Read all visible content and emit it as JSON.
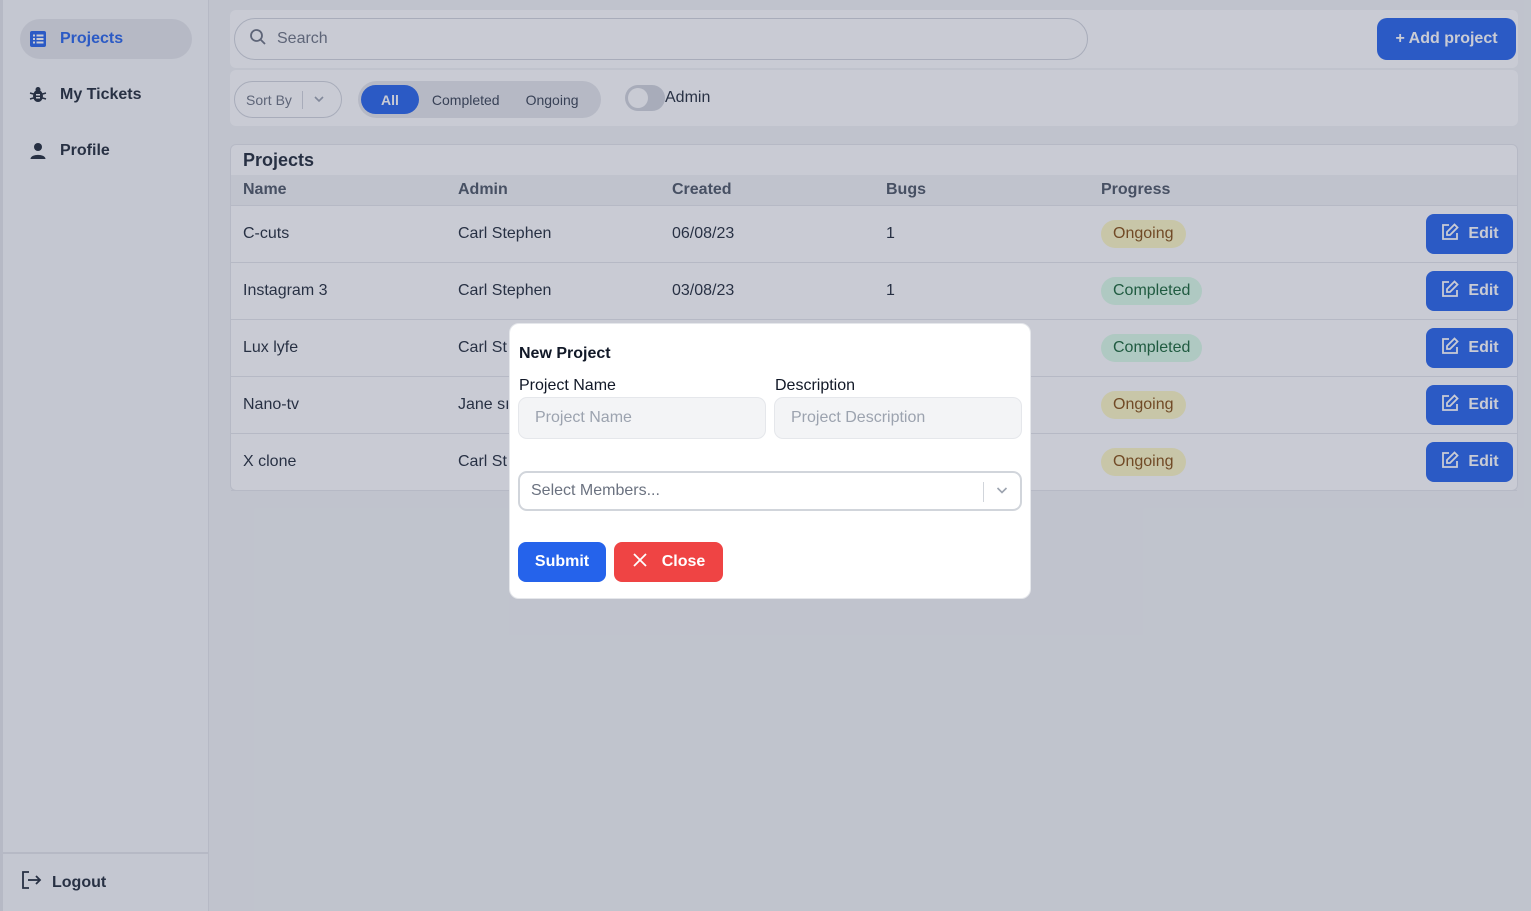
{
  "sidebar": {
    "items": [
      {
        "label": "Projects",
        "icon": "list-icon",
        "active": true
      },
      {
        "label": "My Tickets",
        "icon": "bug-icon"
      },
      {
        "label": "Profile",
        "icon": "user-icon"
      }
    ],
    "logout_label": "Logout"
  },
  "toolbar": {
    "search_placeholder": "Search",
    "add_label": "+ Add project"
  },
  "filters": {
    "sort_label": "Sort By",
    "segments": [
      "All",
      "Completed",
      "Ongoing"
    ],
    "active_segment": "All",
    "admin_label": "Admin",
    "admin_on": false
  },
  "table": {
    "title": "Projects",
    "columns": [
      "Name",
      "Admin",
      "Created",
      "Bugs",
      "Progress"
    ],
    "rows": [
      {
        "name": "C-cuts",
        "admin": "Carl Stephen",
        "created": "06/08/23",
        "bugs": "1",
        "progress": "Ongoing",
        "edit": "Edit"
      },
      {
        "name": "Instagram 3",
        "admin": "Carl Stephen",
        "created": "03/08/23",
        "bugs": "1",
        "progress": "Completed",
        "edit": "Edit"
      },
      {
        "name": "Lux lyfe",
        "admin": "Carl St",
        "created": "",
        "bugs": "",
        "progress": "Completed",
        "edit": "Edit"
      },
      {
        "name": "Nano-tv",
        "admin": "Jane sı",
        "created": "",
        "bugs": "",
        "progress": "Ongoing",
        "edit": "Edit"
      },
      {
        "name": "X clone",
        "admin": "Carl St",
        "created": "",
        "bugs": "",
        "progress": "Ongoing",
        "edit": "Edit"
      }
    ]
  },
  "modal": {
    "title": "New Project",
    "name_label": "Project Name",
    "name_placeholder": "Project Name",
    "desc_label": "Description",
    "desc_placeholder": "Project Description",
    "members_placeholder": "Select Members...",
    "submit_label": "Submit",
    "close_label": "Close"
  },
  "colors": {
    "primary": "#2563eb",
    "danger": "#ef4444",
    "ongoing_bg": "#fef9c3",
    "completed_bg": "#dcfce7"
  }
}
